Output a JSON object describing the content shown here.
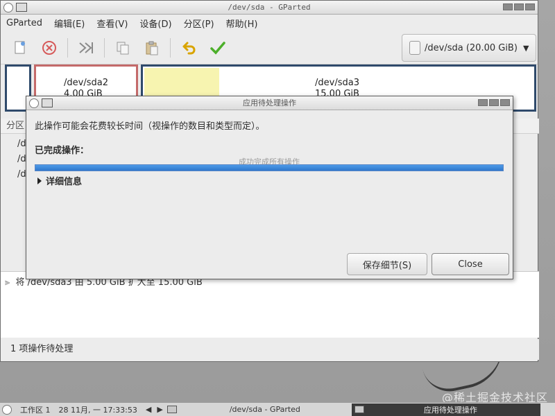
{
  "main_window": {
    "title": "/dev/sda - GParted"
  },
  "menu": [
    {
      "label": "GParted"
    },
    {
      "label": "编辑(E)"
    },
    {
      "label": "查看(V)"
    },
    {
      "label": "设备(D)"
    },
    {
      "label": "分区(P)"
    },
    {
      "label": "帮助(H)"
    }
  ],
  "device_selector": {
    "value": "/dev/sda  (20.00 GiB)"
  },
  "partition_map": {
    "sda2": {
      "name": "/dev/sda2",
      "size": "4.00 GiB"
    },
    "sda3": {
      "name": "/dev/sda3",
      "size": "15.00 GiB"
    }
  },
  "partition_table": {
    "header": "分区",
    "rows": [
      "/d",
      "/d",
      "/d"
    ]
  },
  "pending": {
    "item": "将 /dev/sda3 由 5.00 GiB 扩大至 15.00 GiB"
  },
  "statusbar": {
    "text": "1 项操作待处理"
  },
  "dialog": {
    "title": "应用待处理操作",
    "message": "此操作可能会花费较长时间（视操作的数目和类型而定）。",
    "completed_label": "已完成操作：",
    "progress_text": "成功完成所有操作",
    "progress_fraction": 1.0,
    "details_label": "详细信息",
    "save_button": "保存细节(S)",
    "close_button": "Close"
  },
  "taskbar": {
    "workspace": "工作区 1",
    "datetime": "28 11月, 一 17:33:53",
    "task_1": "/dev/sda - GParted",
    "task_2": "应用待处理操作"
  },
  "watermark": "@稀土掘金技术社区"
}
